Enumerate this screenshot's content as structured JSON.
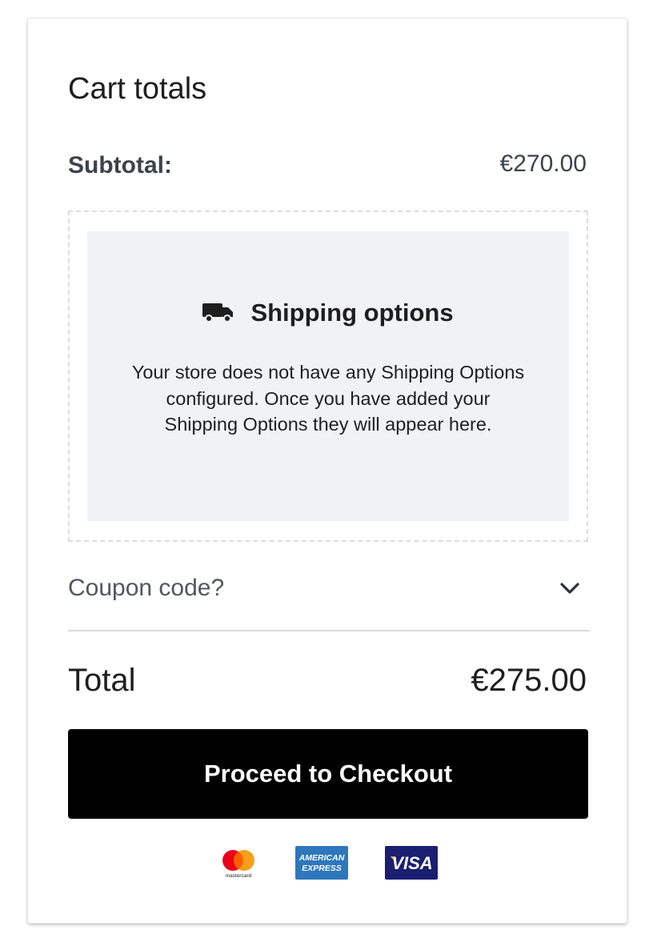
{
  "cart": {
    "title": "Cart totals",
    "subtotal_label": "Subtotal:",
    "subtotal_value": "€270.00",
    "shipping": {
      "title": "Shipping options",
      "description": "Your store does not have any Shipping Options configured. Once you have added your Shipping Options they will appear here.",
      "icon": "truck-icon"
    },
    "coupon": {
      "label": "Coupon code?",
      "icon": "chevron-down-icon"
    },
    "total_label": "Total",
    "total_value": "€275.00",
    "checkout_label": "Proceed to Checkout",
    "payment_methods": [
      {
        "name": "mastercard",
        "text": "mastercard"
      },
      {
        "name": "american-express",
        "text": "AMERICAN EXPRESS"
      },
      {
        "name": "visa",
        "text": "VISA"
      }
    ]
  },
  "colors": {
    "button_bg": "#000000",
    "shipping_bg": "#f1f2f4",
    "divider": "#dcdcde",
    "mastercard_red": "#eb001b",
    "mastercard_orange": "#f79e1b",
    "amex_blue": "#2e77bc",
    "visa_blue": "#1a1f71"
  }
}
